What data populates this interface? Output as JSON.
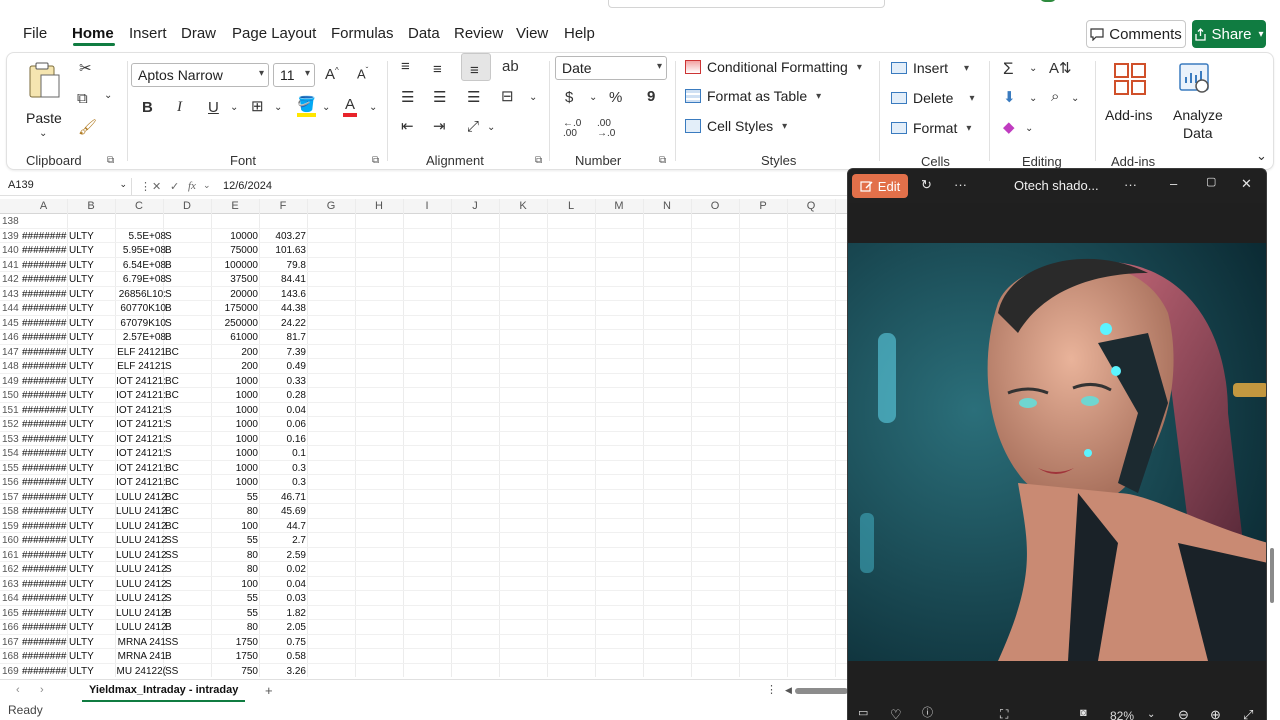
{
  "menu": {
    "items": [
      "File",
      "Home",
      "Insert",
      "Draw",
      "Page Layout",
      "Formulas",
      "Data",
      "Review",
      "View",
      "Help"
    ],
    "active": "Home",
    "comments": "Comments",
    "share": "Share"
  },
  "ribbon": {
    "clipboard": {
      "label": "Clipboard",
      "paste": "Paste"
    },
    "font": {
      "label": "Font",
      "name": "Aptos Narrow",
      "size": "11"
    },
    "alignment": {
      "label": "Alignment"
    },
    "number": {
      "label": "Number",
      "format": "Date"
    },
    "styles": {
      "label": "Styles",
      "conditional": "Conditional Formatting",
      "format_table": "Format as Table",
      "cell_styles": "Cell Styles"
    },
    "cells": {
      "label": "Cells",
      "insert": "Insert",
      "delete": "Delete",
      "format": "Format"
    },
    "editing": {
      "label": "Editing"
    },
    "addins": {
      "label": "Add-ins",
      "addins_btn": "Add-ins",
      "analyze_line1": "Analyze",
      "analyze_line2": "Data"
    }
  },
  "formula_bar": {
    "name_box": "A139",
    "fx": "fx",
    "value": "12/6/2024"
  },
  "columns": [
    "A",
    "B",
    "C",
    "D",
    "E",
    "F",
    "G",
    "H",
    "I",
    "J",
    "K",
    "L",
    "M",
    "N",
    "O",
    "P",
    "Q"
  ],
  "rows": [
    {
      "n": "138",
      "a": "",
      "b": "",
      "c": "",
      "d": "",
      "e": "",
      "f": ""
    },
    {
      "n": "139",
      "a": "########",
      "b": "ULTY",
      "c": "5.5E+08",
      "d": "S",
      "e": "10000",
      "f": "403.27"
    },
    {
      "n": "140",
      "a": "########",
      "b": "ULTY",
      "c": "5.95E+08",
      "d": "B",
      "e": "75000",
      "f": "101.63"
    },
    {
      "n": "141",
      "a": "########",
      "b": "ULTY",
      "c": "6.54E+08",
      "d": "B",
      "e": "100000",
      "f": "79.8"
    },
    {
      "n": "142",
      "a": "########",
      "b": "ULTY",
      "c": "6.79E+08",
      "d": "S",
      "e": "37500",
      "f": "84.41"
    },
    {
      "n": "143",
      "a": "########",
      "b": "ULTY",
      "c": "26856L10:",
      "d": "S",
      "e": "20000",
      "f": "143.6"
    },
    {
      "n": "144",
      "a": "########",
      "b": "ULTY",
      "c": "60770K10",
      "d": "B",
      "e": "175000",
      "f": "44.38"
    },
    {
      "n": "145",
      "a": "########",
      "b": "ULTY",
      "c": "67079K10",
      "d": "S",
      "e": "250000",
      "f": "24.22"
    },
    {
      "n": "146",
      "a": "########",
      "b": "ULTY",
      "c": "2.57E+08",
      "d": "B",
      "e": "61000",
      "f": "81.7"
    },
    {
      "n": "147",
      "a": "########",
      "b": "ULTY",
      "c": "ELF 24121",
      "d": "BC",
      "e": "200",
      "f": "7.39"
    },
    {
      "n": "148",
      "a": "########",
      "b": "ULTY",
      "c": "ELF 24121",
      "d": "S",
      "e": "200",
      "f": "0.49"
    },
    {
      "n": "149",
      "a": "########",
      "b": "ULTY",
      "c": "IOT 24121:",
      "d": "BC",
      "e": "1000",
      "f": "0.33"
    },
    {
      "n": "150",
      "a": "########",
      "b": "ULTY",
      "c": "IOT 24121:",
      "d": "BC",
      "e": "1000",
      "f": "0.28"
    },
    {
      "n": "151",
      "a": "########",
      "b": "ULTY",
      "c": "IOT 24121:",
      "d": "S",
      "e": "1000",
      "f": "0.04"
    },
    {
      "n": "152",
      "a": "########",
      "b": "ULTY",
      "c": "IOT 24121:",
      "d": "S",
      "e": "1000",
      "f": "0.06"
    },
    {
      "n": "153",
      "a": "########",
      "b": "ULTY",
      "c": "IOT 24121:",
      "d": "S",
      "e": "1000",
      "f": "0.16"
    },
    {
      "n": "154",
      "a": "########",
      "b": "ULTY",
      "c": "IOT 24121:",
      "d": "S",
      "e": "1000",
      "f": "0.1"
    },
    {
      "n": "155",
      "a": "########",
      "b": "ULTY",
      "c": "IOT 24121:",
      "d": "BC",
      "e": "1000",
      "f": "0.3"
    },
    {
      "n": "156",
      "a": "########",
      "b": "ULTY",
      "c": "IOT 24121:",
      "d": "BC",
      "e": "1000",
      "f": "0.3"
    },
    {
      "n": "157",
      "a": "########",
      "b": "ULTY",
      "c": "LULU 2412",
      "d": "BC",
      "e": "55",
      "f": "46.71"
    },
    {
      "n": "158",
      "a": "########",
      "b": "ULTY",
      "c": "LULU 2412",
      "d": "BC",
      "e": "80",
      "f": "45.69"
    },
    {
      "n": "159",
      "a": "########",
      "b": "ULTY",
      "c": "LULU 2412",
      "d": "BC",
      "e": "100",
      "f": "44.7"
    },
    {
      "n": "160",
      "a": "########",
      "b": "ULTY",
      "c": "LULU 2412",
      "d": "SS",
      "e": "55",
      "f": "2.7"
    },
    {
      "n": "161",
      "a": "########",
      "b": "ULTY",
      "c": "LULU 2412",
      "d": "SS",
      "e": "80",
      "f": "2.59"
    },
    {
      "n": "162",
      "a": "########",
      "b": "ULTY",
      "c": "LULU 2412",
      "d": "S",
      "e": "80",
      "f": "0.02"
    },
    {
      "n": "163",
      "a": "########",
      "b": "ULTY",
      "c": "LULU 2412",
      "d": "S",
      "e": "100",
      "f": "0.04"
    },
    {
      "n": "164",
      "a": "########",
      "b": "ULTY",
      "c": "LULU 2412",
      "d": "S",
      "e": "55",
      "f": "0.03"
    },
    {
      "n": "165",
      "a": "########",
      "b": "ULTY",
      "c": "LULU 2412",
      "d": "B",
      "e": "55",
      "f": "1.82"
    },
    {
      "n": "166",
      "a": "########",
      "b": "ULTY",
      "c": "LULU 2412",
      "d": "B",
      "e": "80",
      "f": "2.05"
    },
    {
      "n": "167",
      "a": "########",
      "b": "ULTY",
      "c": "MRNA 241",
      "d": "SS",
      "e": "1750",
      "f": "0.75"
    },
    {
      "n": "168",
      "a": "########",
      "b": "ULTY",
      "c": "MRNA 241",
      "d": "B",
      "e": "1750",
      "f": "0.58"
    },
    {
      "n": "169",
      "a": "########",
      "b": "ULTY",
      "c": "MU 24122(",
      "d": "SS",
      "e": "750",
      "f": "3.26"
    }
  ],
  "sheet_tab": "Yieldmax_Intraday - intraday",
  "status": "Ready",
  "viewer": {
    "edit": "Edit",
    "title": "Otech shado...",
    "zoom": "82%"
  },
  "colors": {
    "accent": "#107c41",
    "edit": "#e2704a"
  }
}
